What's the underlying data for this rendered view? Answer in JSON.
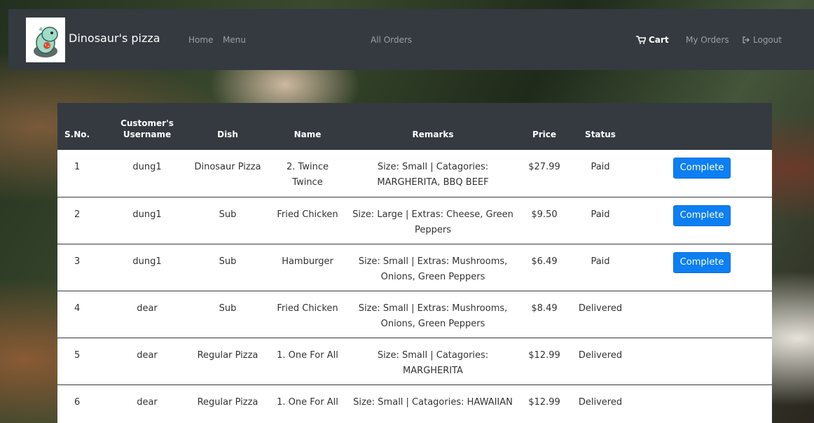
{
  "navbar": {
    "brand": "Dinosaur's pizza",
    "home": "Home",
    "menu": "Menu",
    "all_orders": "All Orders",
    "cart": "Cart",
    "my_orders": "My Orders",
    "logout": "Logout"
  },
  "table": {
    "headers": [
      "S.No.",
      "Customer's Username",
      "Dish",
      "Name",
      "Remarks",
      "Price",
      "Status",
      ""
    ],
    "rows": [
      {
        "sno": "1",
        "user": "dung1",
        "dish": "Dinosaur Pizza",
        "name": "2. Twince Twince",
        "remarks": "Size: Small | Catagories: MARGHERITA, BBQ BEEF",
        "price": "$27.99",
        "status": "Paid",
        "action": "Complete"
      },
      {
        "sno": "2",
        "user": "dung1",
        "dish": "Sub",
        "name": "Fried Chicken",
        "remarks": "Size: Large | Extras: Cheese, Green Peppers",
        "price": "$9.50",
        "status": "Paid",
        "action": "Complete"
      },
      {
        "sno": "3",
        "user": "dung1",
        "dish": "Sub",
        "name": "Hamburger",
        "remarks": "Size: Small | Extras: Mushrooms, Onions, Green Peppers",
        "price": "$6.49",
        "status": "Paid",
        "action": "Complete"
      },
      {
        "sno": "4",
        "user": "dear",
        "dish": "Sub",
        "name": "Fried Chicken",
        "remarks": "Size: Small | Extras: Mushrooms, Onions, Green Peppers",
        "price": "$8.49",
        "status": "Delivered",
        "action": ""
      },
      {
        "sno": "5",
        "user": "dear",
        "dish": "Regular Pizza",
        "name": "1. One For All",
        "remarks": "Size: Small | Catagories: MARGHERITA",
        "price": "$12.99",
        "status": "Delivered",
        "action": ""
      },
      {
        "sno": "6",
        "user": "dear",
        "dish": "Regular Pizza",
        "name": "1. One For All",
        "remarks": "Size: Small | Catagories: HAWAIIAN",
        "price": "$12.99",
        "status": "Delivered",
        "action": ""
      }
    ]
  },
  "colors": {
    "navbar": "#343a40",
    "button": "#0d7ff2"
  },
  "icons": {
    "cart": "cart-icon",
    "logout": "logout-icon",
    "logo": "dinosaur-logo"
  }
}
